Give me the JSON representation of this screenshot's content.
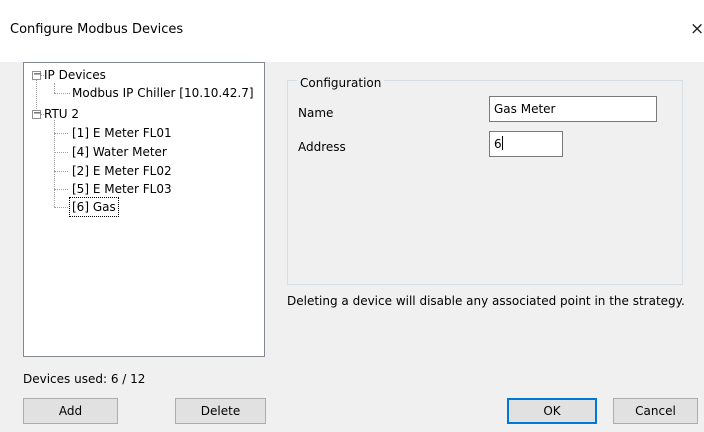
{
  "window": {
    "title": "Configure Modbus Devices",
    "close_glyph": "×"
  },
  "tree": {
    "groups": [
      {
        "label": "IP Devices",
        "expander": "−",
        "children": [
          "Modbus IP Chiller [10.10.42.7]"
        ]
      },
      {
        "label": "RTU 2",
        "expander": "−",
        "children": [
          "[1] E Meter FL01",
          "[4] Water Meter",
          "[2] E Meter FL02",
          "[5] E Meter FL03",
          "[6] Gas"
        ]
      }
    ],
    "selected": "[6] Gas"
  },
  "devices_used": "Devices used: 6 / 12",
  "buttons": {
    "add": "Add",
    "delete": "Delete",
    "ok": "OK",
    "cancel": "Cancel"
  },
  "configuration": {
    "legend": "Configuration",
    "name_label": "Name",
    "name_value": "Gas Meter",
    "address_label": "Address",
    "address_value": "6"
  },
  "note": "Deleting a device will disable any associated point in the strategy."
}
